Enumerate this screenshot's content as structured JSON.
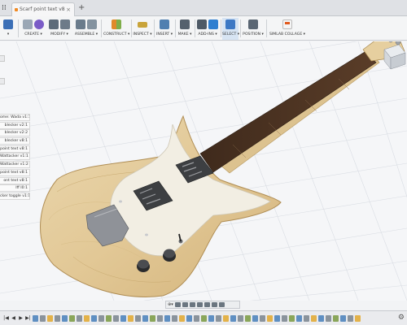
{
  "tabs": {
    "active_tab": "Scarf point text v8",
    "active_tab_close": "×",
    "new_tab": "+"
  },
  "quick_access": {
    "grid_glyph": "⁞⁞",
    "file_glyph": "▾",
    "save_glyph": "▭",
    "undo_glyph": "↶"
  },
  "toolbar": {
    "groups": [
      {
        "label": "▾",
        "icon": "design-workspace-icon",
        "color": "#3b6fb6"
      },
      {
        "label": "CREATE ▾",
        "icon": "create-box-icon",
        "color": "#7a5cc7"
      },
      {
        "label": "MODIFY ▾",
        "icon": "modify-push-pull-icon",
        "color": "#5c6b7a"
      },
      {
        "label": "ASSEMBLE ▾",
        "icon": "assemble-joint-icon",
        "color": "#6a7c8c"
      },
      {
        "label": "CONSTRUCT ▾",
        "icon": "construct-plane-icon",
        "color": "#e08a2a"
      },
      {
        "label": "INSPECT ▾",
        "icon": "inspect-measure-icon",
        "color": "#c9a43a"
      },
      {
        "label": "INSERT ▾",
        "icon": "insert-image-icon",
        "color": "#4f7fb0"
      },
      {
        "label": "MAKE ▾",
        "icon": "make-3dprint-icon",
        "color": "#55616d"
      },
      {
        "label": "ADD-INS ▾",
        "icon": "add-ins-gear-icon",
        "color": "#4e5a66"
      },
      {
        "label": "SELECT ▾",
        "icon": "select-cursor-icon",
        "color": "#3d78c4"
      },
      {
        "label": "POSITION ▾",
        "icon": "position-capture-icon",
        "color": "#5a6673"
      },
      {
        "label": "SIMLAB COLLAGE ▾",
        "icon": "simlab-collage-icon",
        "color": "#e05a1e"
      }
    ]
  },
  "browser": {
    "items": [
      "ome: Wada v1:1",
      "blecker v2:1",
      "blecker v2:2",
      "blecker v8:1",
      "point text v8:1",
      "Wattacker v1:1",
      "Wattacker v1:2",
      "point text v8:1",
      "ont text v8:1",
      "Iff I0:1",
      "cker toggle v1:1"
    ]
  },
  "navbar": {
    "zoom_glyph": "⊕▾"
  },
  "timeline": {
    "first": "|◀",
    "prev": "◀",
    "play": "▶",
    "next": "▶|",
    "settings": "⚙"
  },
  "colors": {
    "canvas_bg": "#f5f6f8",
    "grid": "#d9dde3",
    "body_wood": "#e2c896",
    "pickguard": "#f2eee3",
    "fretboard": "#4d3322",
    "neck": "#d9bf8c",
    "bridge": "#8f9298"
  }
}
